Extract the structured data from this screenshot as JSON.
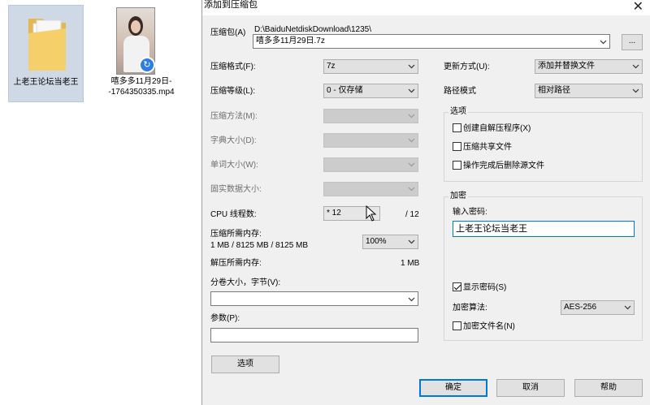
{
  "desktop": {
    "folder_label": "上老王论坛当老王",
    "video_label": "嘻多多11月29日--1764350335.mp4"
  },
  "dialog": {
    "title": "添加到压缩包",
    "archive": {
      "label": "压缩包(A)",
      "path": "D:\\BaiduNetdiskDownload\\1235\\",
      "name": "嘻多多11月29日.7z",
      "browse_label": "..."
    },
    "format": {
      "label": "压缩格式(F):",
      "value": "7z"
    },
    "level": {
      "label": "压缩等级(L):",
      "value": "0 - 仅存储"
    },
    "method": {
      "label": "压缩方法(M):",
      "value": ""
    },
    "dict": {
      "label": "字典大小(D):",
      "value": ""
    },
    "word": {
      "label": "单词大小(W):",
      "value": ""
    },
    "solid": {
      "label": "固实数据大小:",
      "value": ""
    },
    "cpu": {
      "label": "CPU 线程数:",
      "value": "* 12",
      "total": "/ 12"
    },
    "mem_compress": {
      "label": "压缩所需内存:",
      "detail": "1 MB / 8125 MB / 8125 MB",
      "percent": "100%"
    },
    "mem_decompress": {
      "label": "解压所需内存:",
      "value": "1 MB"
    },
    "volume": {
      "label": "分卷大小，字节(V):",
      "value": ""
    },
    "params": {
      "label": "参数(P):",
      "value": ""
    },
    "options_button": "选项",
    "update": {
      "label": "更新方式(U):",
      "value": "添加并替换文件"
    },
    "path_mode": {
      "label": "路径模式",
      "value": "相对路径"
    },
    "options_group": {
      "title": "选项",
      "sfx": "创建自解压程序(X)",
      "shared": "压缩共享文件",
      "delete": "操作完成后删除源文件"
    },
    "encryption": {
      "title": "加密",
      "password_label": "输入密码:",
      "password": "上老王论坛当老王",
      "show_password": "显示密码(S)",
      "method_label": "加密算法:",
      "method": "AES-256",
      "encrypt_names": "加密文件名(N)"
    },
    "ok": "确定",
    "cancel": "取消",
    "help": "帮助",
    "close": "✕"
  }
}
